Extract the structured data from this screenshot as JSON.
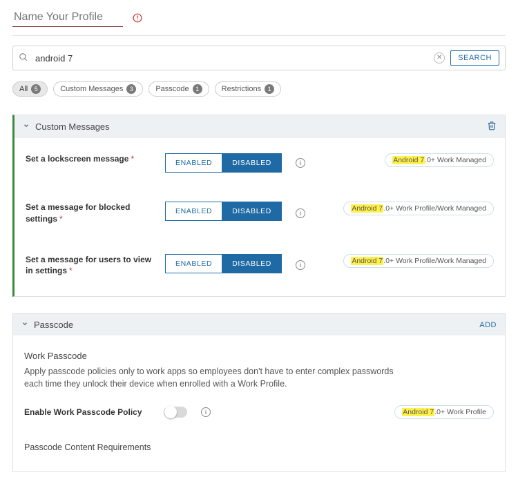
{
  "header": {
    "profile_name_placeholder": "Name Your Profile"
  },
  "search": {
    "value": "android 7",
    "button": "SEARCH"
  },
  "filters": [
    {
      "label": "All",
      "count": "5",
      "active": true
    },
    {
      "label": "Custom Messages",
      "count": "3",
      "active": false
    },
    {
      "label": "Passcode",
      "count": "1",
      "active": false
    },
    {
      "label": "Restrictions",
      "count": "1",
      "active": false
    }
  ],
  "custom_messages": {
    "title": "Custom Messages",
    "enabled_label": "ENABLED",
    "disabled_label": "DISABLED",
    "rows": [
      {
        "label": "Set a lockscreen message",
        "tag_hl": "Android 7",
        "tag_rest": ".0+ Work Managed"
      },
      {
        "label": "Set a message for blocked settings",
        "tag_hl": "Android 7",
        "tag_rest": ".0+ Work Profile/Work Managed"
      },
      {
        "label": "Set a message for users to view in settings",
        "tag_hl": "Android 7",
        "tag_rest": ".0+ Work Profile/Work Managed"
      }
    ]
  },
  "passcode": {
    "title": "Passcode",
    "add": "ADD",
    "sub_title": "Work Passcode",
    "description": "Apply passcode policies only to work apps so employees don't have to enter complex passwords each time they unlock their device when enrolled with a Work Profile.",
    "enable_label": "Enable Work Passcode Policy",
    "tag_hl": "Android 7",
    "tag_rest": ".0+ Work Profile",
    "content_req": "Passcode Content Requirements"
  }
}
